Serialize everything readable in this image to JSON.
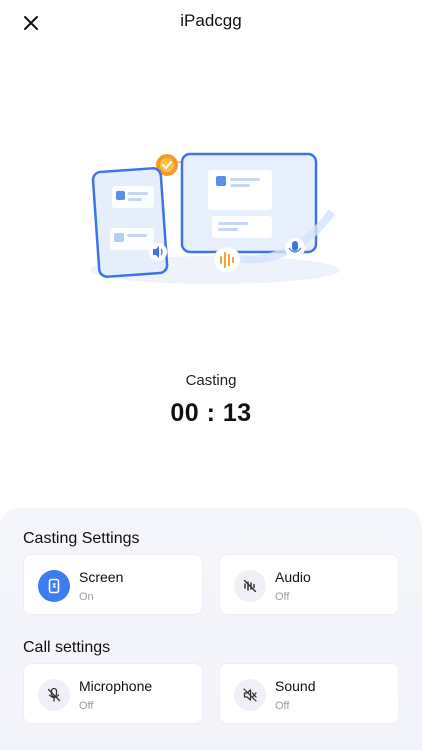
{
  "header": {
    "title": "iPadcgg",
    "close_icon": "close-icon"
  },
  "illustration": {
    "icons": [
      "phone-device-icon",
      "monitor-device-icon",
      "check-badge-icon",
      "speaker-icon",
      "waveform-icon",
      "mic-icon"
    ]
  },
  "status": {
    "label": "Casting",
    "timer": "00 : 13"
  },
  "casting_settings": {
    "title": "Casting Settings",
    "items": [
      {
        "label": "Screen",
        "state": "On",
        "icon": "screen-icon",
        "active": true
      },
      {
        "label": "Audio",
        "state": "Off",
        "icon": "audio-off-icon",
        "active": false
      }
    ]
  },
  "call_settings": {
    "title": "Call settings",
    "items": [
      {
        "label": "Microphone",
        "state": "Off",
        "icon": "microphone-off-icon",
        "active": false
      },
      {
        "label": "Sound",
        "state": "Off",
        "icon": "sound-off-icon",
        "active": false
      }
    ]
  },
  "colors": {
    "accent": "#3d7cf0",
    "panel_bg": "#f5f6fb",
    "muted_text": "#9a9ca3"
  }
}
